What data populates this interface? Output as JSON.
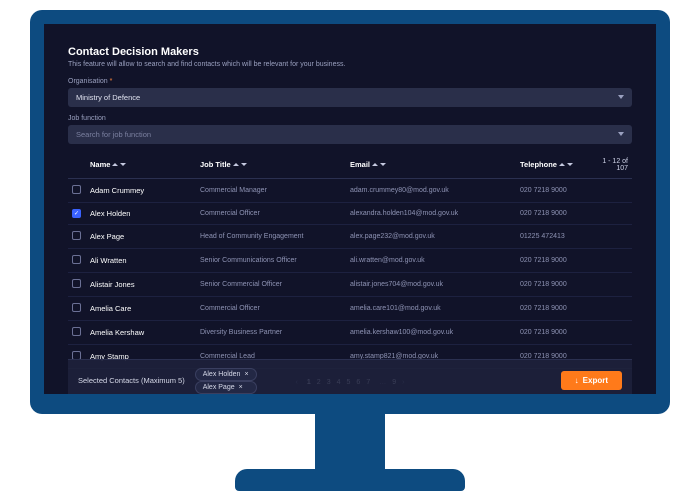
{
  "header": {
    "title": "Contact Decision Makers",
    "subtitle": "This feature will allow to search and find contacts which will be relevant for your business."
  },
  "filters": {
    "org_label": "Organisation",
    "org_value": "Ministry of Defence",
    "job_label": "Job function",
    "job_placeholder": "Search for job function"
  },
  "table": {
    "headers": {
      "name": "Name",
      "job_title": "Job Title",
      "email": "Email",
      "telephone": "Telephone"
    },
    "range": "1 - 12 of 107",
    "rows": [
      {
        "checked": false,
        "name": "Adam Crummey",
        "title": "Commercial Manager",
        "email": "adam.crummey80@mod.gov.uk",
        "tel": "020 7218 9000"
      },
      {
        "checked": true,
        "name": "Alex Holden",
        "title": "Commercial Officer",
        "email": "alexandra.holden104@mod.gov.uk",
        "tel": "020 7218 9000"
      },
      {
        "checked": false,
        "name": "Alex Page",
        "title": "Head of Community Engagement",
        "email": "alex.page232@mod.gov.uk",
        "tel": "01225 472413"
      },
      {
        "checked": false,
        "name": "Ali Wratten",
        "title": "Senior Communications Officer",
        "email": "ali.wratten@mod.gov.uk",
        "tel": "020 7218 9000"
      },
      {
        "checked": false,
        "name": "Alistair Jones",
        "title": "Senior Commercial Officer",
        "email": "alistair.jones704@mod.gov.uk",
        "tel": "020 7218 9000"
      },
      {
        "checked": false,
        "name": "Amelia Care",
        "title": "Commercial Officer",
        "email": "amelia.care101@mod.gov.uk",
        "tel": "020 7218 9000"
      },
      {
        "checked": false,
        "name": "Amelia Kershaw",
        "title": "Diversity Business Partner",
        "email": "amelia.kershaw100@mod.gov.uk",
        "tel": "020 7218 9000"
      },
      {
        "checked": false,
        "name": "Amy Stamp",
        "title": "Commercial Lead",
        "email": "amy.stamp821@mod.gov.uk",
        "tel": "020 7218 9000"
      }
    ]
  },
  "pagination": {
    "pages": [
      "1",
      "2",
      "3",
      "4",
      "5",
      "6",
      "7"
    ],
    "ellipsis": "…",
    "last": "9"
  },
  "selected": {
    "label": "Selected Contacts (Maximum 5)",
    "chips": [
      "Alex Holden",
      "Alex Page"
    ]
  },
  "export_label": "Export"
}
